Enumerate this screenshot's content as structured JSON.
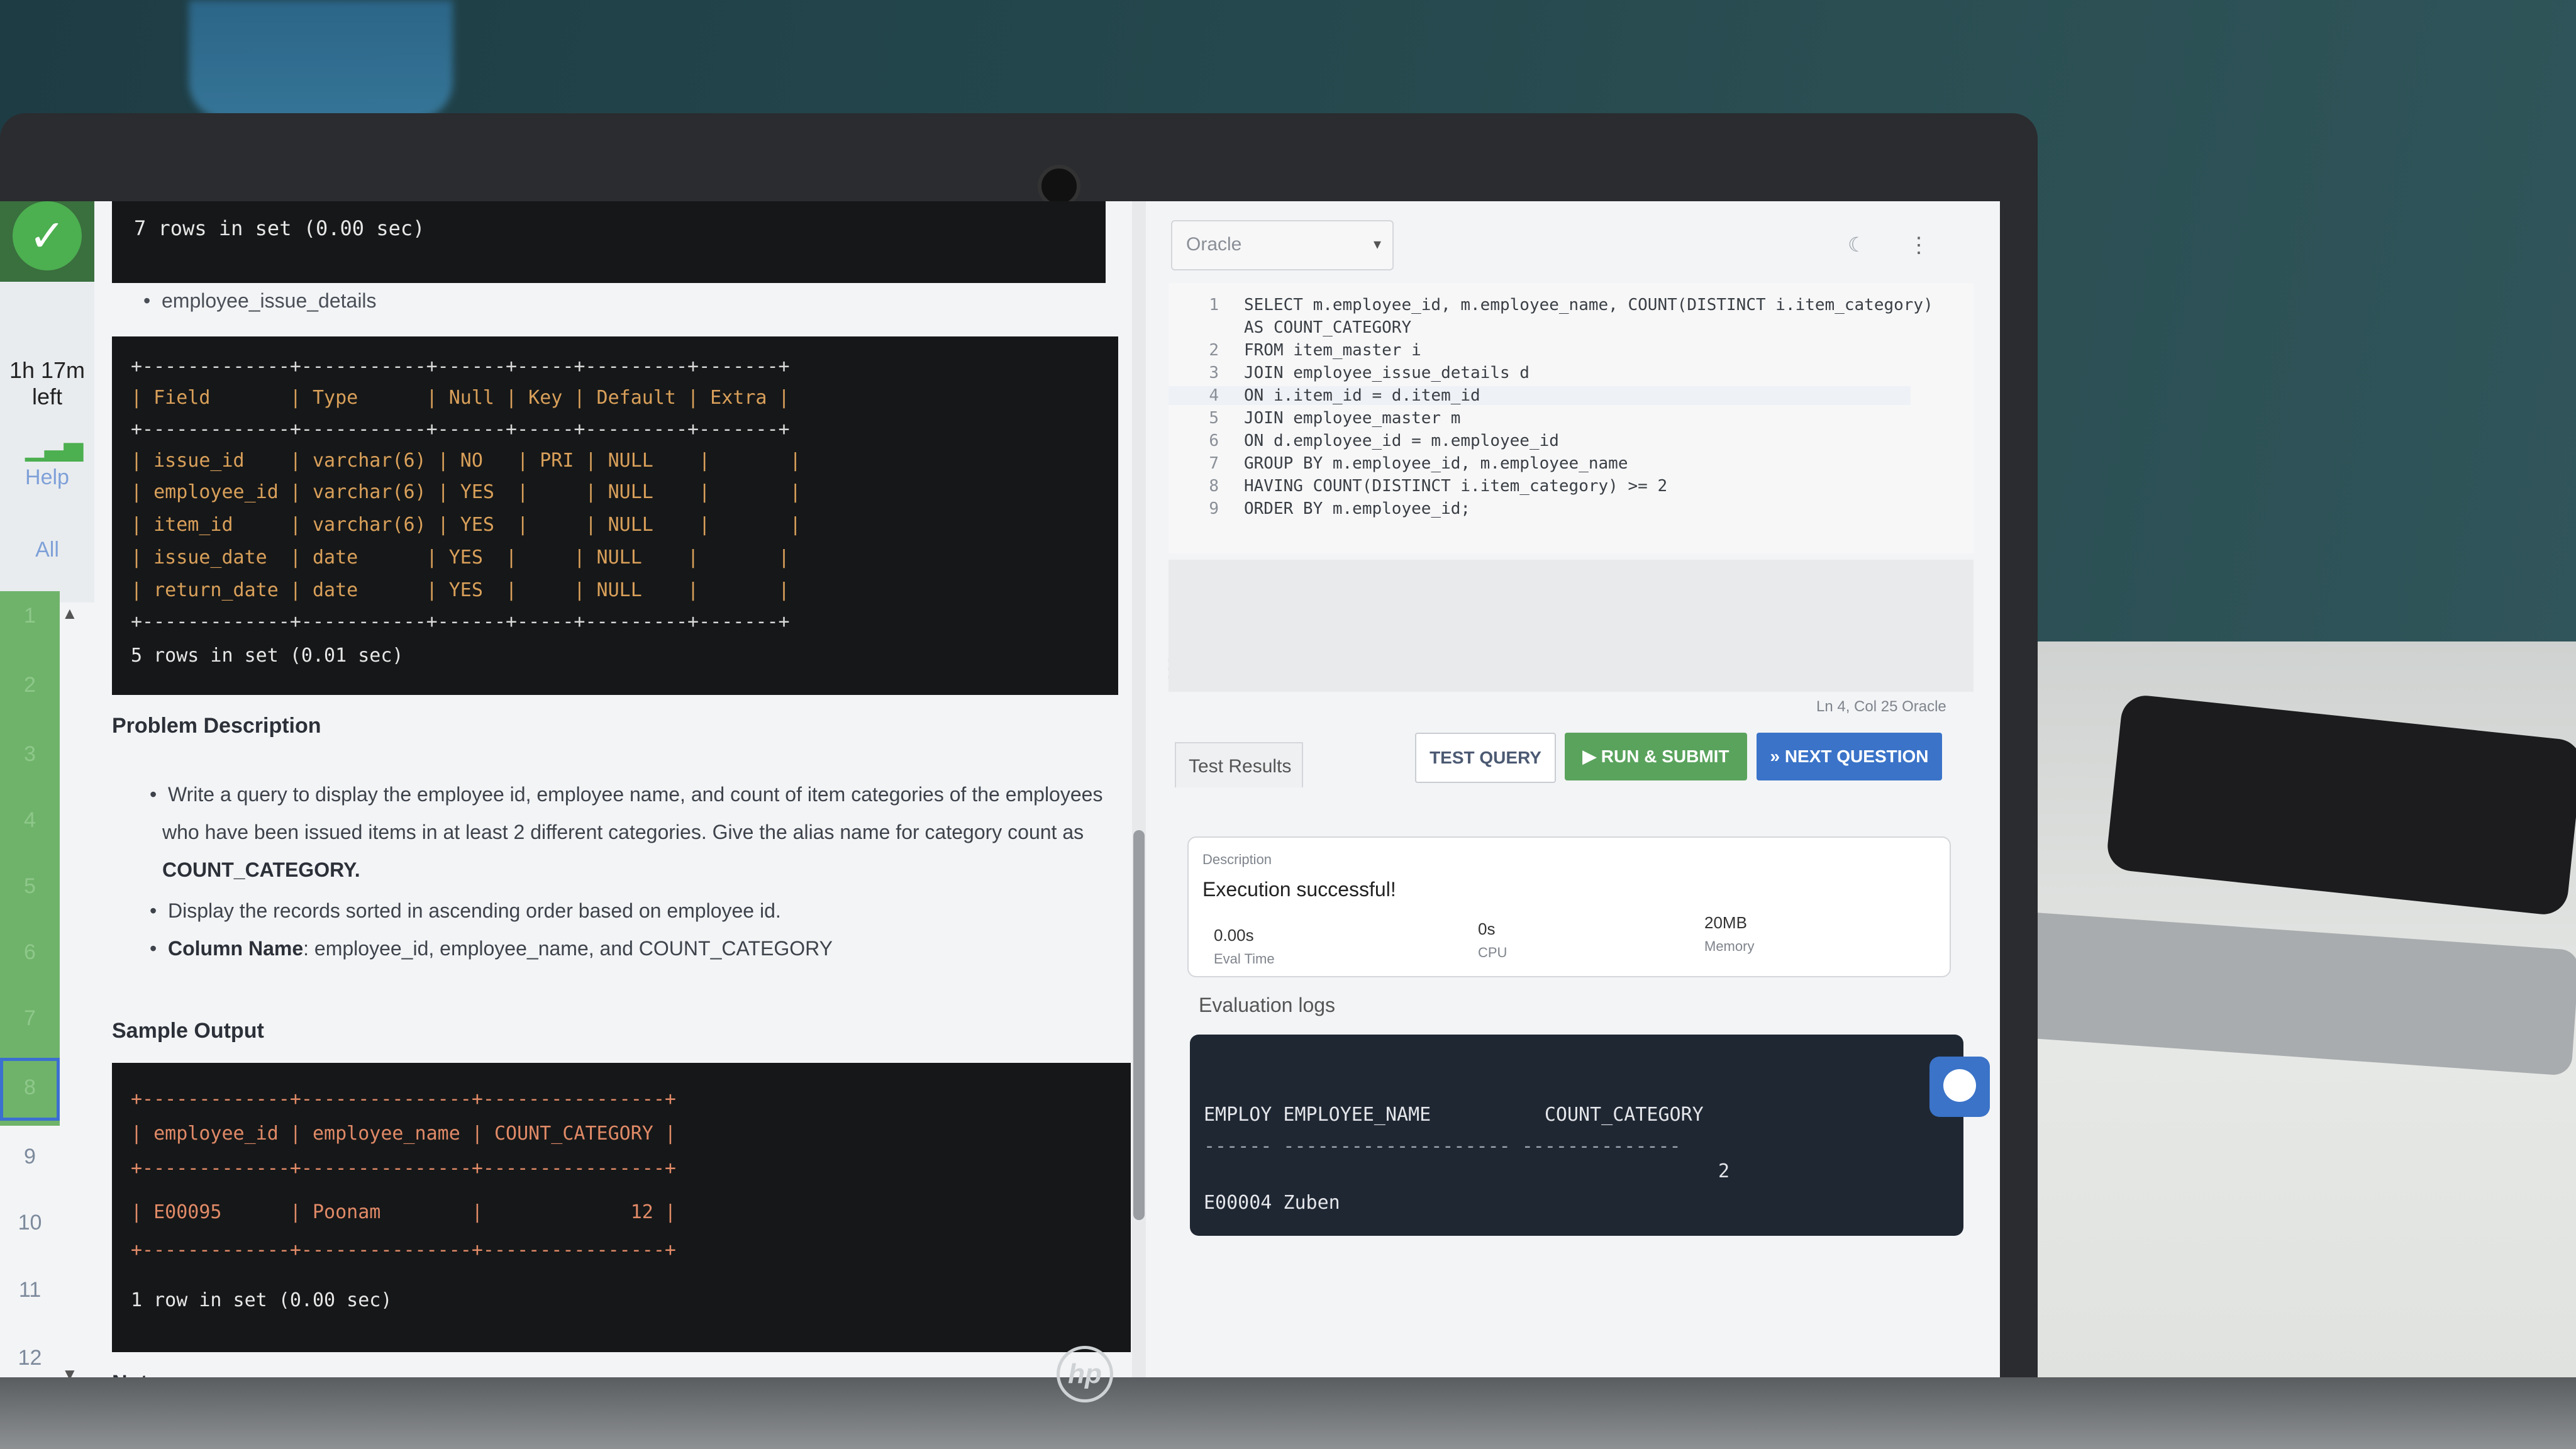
{
  "rail": {
    "time_line1": "1h 17m",
    "time_line2": "left",
    "help": "Help",
    "all": "All",
    "numbers": [
      "1",
      "2",
      "3",
      "4",
      "5",
      "6",
      "7",
      "8",
      "9",
      "10",
      "11",
      "12"
    ]
  },
  "top_terminal": {
    "line": "7 rows in set (0.00 sec)"
  },
  "table_name": "employee_issue_details",
  "schema_terminal": {
    "lines": [
      "+-------------+-----------+------+-----+---------+-------+",
      "| Field       | Type      | Null | Key | Default | Extra |",
      "+-------------+-----------+------+-----+---------+-------+",
      "| issue_id    | varchar(6) | NO   | PRI | NULL    |       |",
      "| employee_id | varchar(6) | YES  |     | NULL    |       |",
      "| item_id     | varchar(6) | YES  |     | NULL    |       |",
      "| issue_date  | date      | YES  |     | NULL    |       |",
      "| return_date | date      | YES  |     | NULL    |       |",
      "+-------------+-----------+------+-----+---------+-------+",
      "5 rows in set (0.01 sec)"
    ]
  },
  "problem": {
    "heading": "Problem Description",
    "line1": "Write a query to display the employee id, employee name, and count of item categories of the employees",
    "line2": "who have been issued items in at least 2 different categories. Give the alias name for category count as",
    "line3": "COUNT_CATEGORY.",
    "line4": "Display the records sorted in ascending order based on employee id.",
    "col_label": "Column Name",
    "col_value": ": employee_id, employee_name, and COUNT_CATEGORY"
  },
  "sample": {
    "heading": "Sample Output",
    "lines": [
      "+-------------+---------------+----------------+",
      "| employee_id | employee_name | COUNT_CATEGORY |",
      "+-------------+---------------+----------------+",
      "| E00095      | Poonam        |             12 |",
      "+-------------+---------------+----------------+",
      "1 row in set (0.00 sec)"
    ]
  },
  "note": "Note:",
  "editor": {
    "language": "Oracle",
    "code_lines": [
      {
        "n": "1",
        "t": "SELECT m.employee_id, m.employee_name, COUNT(DISTINCT i.item_category)"
      },
      {
        "n": "",
        "t": "AS COUNT_CATEGORY"
      },
      {
        "n": "2",
        "t": "FROM item_master i"
      },
      {
        "n": "3",
        "t": "JOIN employee_issue_details d"
      },
      {
        "n": "4",
        "t": "ON i.item_id = d.item_id"
      },
      {
        "n": "5",
        "t": "JOIN employee_master m"
      },
      {
        "n": "6",
        "t": "ON d.employee_id = m.employee_id"
      },
      {
        "n": "7",
        "t": "GROUP BY m.employee_id, m.employee_name"
      },
      {
        "n": "8",
        "t": "HAVING COUNT(DISTINCT i.item_category) >= 2"
      },
      {
        "n": "9",
        "t": "ORDER BY m.employee_id;"
      }
    ],
    "status": "Ln 4, Col 25   Oracle"
  },
  "actions": {
    "tab": "Test Results",
    "test": "TEST QUERY",
    "run": "▶ RUN & SUBMIT",
    "next": "» NEXT QUESTION"
  },
  "result": {
    "desc_label": "Description",
    "message": "Execution successful!",
    "eval_time": "0.00s",
    "eval_time_label": "Eval Time",
    "cpu": "0s",
    "cpu_label": "CPU",
    "memory": "20MB",
    "memory_label": "Memory"
  },
  "logs": {
    "heading": "Evaluation logs",
    "header": "EMPLOY EMPLOYEE_NAME          COUNT_CATEGORY",
    "divider": "------ -------------------- --------------",
    "count": "2",
    "row": "E00004 Zuben"
  },
  "colors": {
    "green": "#5aa35d",
    "blue": "#3a73c8",
    "terminal": "#161718"
  }
}
